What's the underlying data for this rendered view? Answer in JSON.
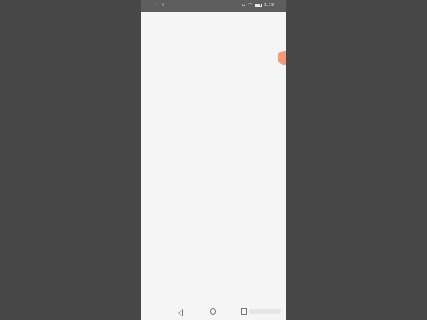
{
  "status_bar": {
    "time": "1:19",
    "left_icons": [
      "notification-icon",
      "sync-icon"
    ],
    "right_icons": [
      "sim-icon",
      "wifi-icon",
      "battery-icon"
    ]
  },
  "colors": {
    "background": "#474747",
    "screen": "#f5f5f5",
    "status_bar": "#5e5e5e",
    "floating_button": "#f39a78"
  },
  "navigation": {
    "icons": [
      "back-icon",
      "home-icon",
      "recent-apps-icon"
    ]
  }
}
